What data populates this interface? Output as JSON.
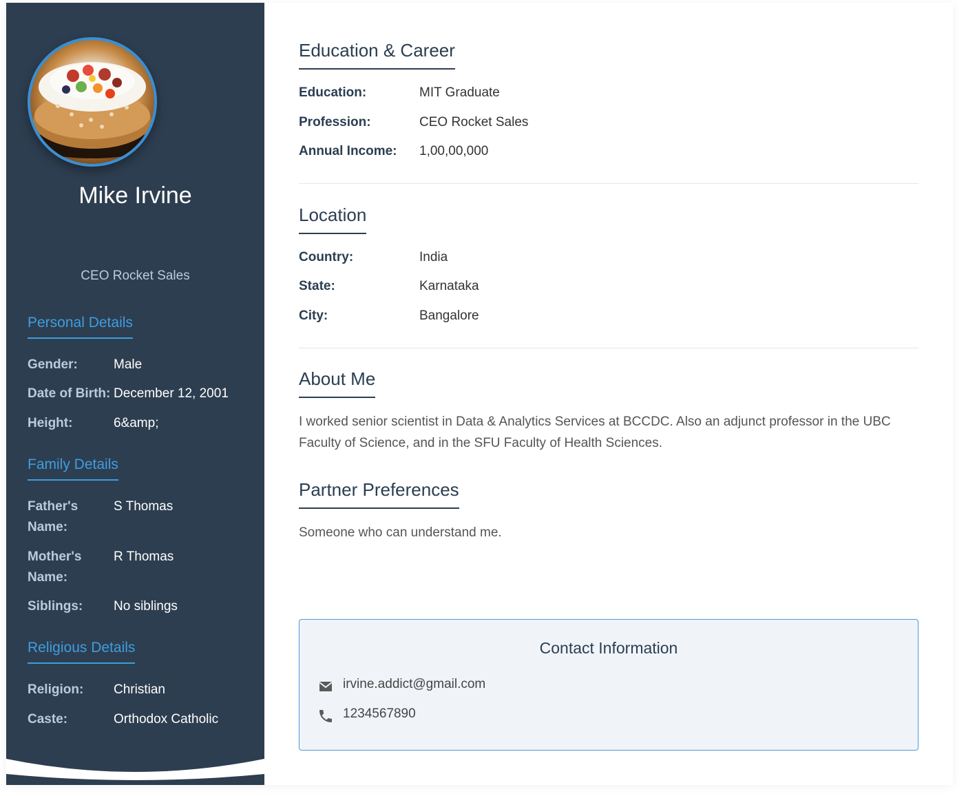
{
  "profile": {
    "name": "Mike Irvine",
    "tagline": "CEO Rocket Sales"
  },
  "personal": {
    "heading": "Personal Details",
    "rows": [
      {
        "label": "Gender:",
        "value": "Male"
      },
      {
        "label": "Date of Birth:",
        "value": "December 12, 2001"
      },
      {
        "label": "Height:",
        "value": "6&amp;"
      }
    ]
  },
  "family": {
    "heading": "Family Details",
    "rows": [
      {
        "label": "Father's Name:",
        "value": "S Thomas"
      },
      {
        "label": "Mother's Name:",
        "value": "R Thomas"
      },
      {
        "label": "Siblings:",
        "value": "No siblings"
      }
    ]
  },
  "religious": {
    "heading": "Religious Details",
    "rows": [
      {
        "label": "Religion:",
        "value": "Christian"
      },
      {
        "label": "Caste:",
        "value": "Orthodox Catholic"
      }
    ]
  },
  "education": {
    "heading": "Education & Career",
    "rows": [
      {
        "label": "Education:",
        "value": "MIT Graduate"
      },
      {
        "label": "Profession:",
        "value": "CEO Rocket Sales"
      },
      {
        "label": "Annual Income:",
        "value": "1,00,00,000"
      }
    ]
  },
  "location": {
    "heading": "Location",
    "rows": [
      {
        "label": "Country:",
        "value": "India"
      },
      {
        "label": "State:",
        "value": "Karnataka"
      },
      {
        "label": "City:",
        "value": "Bangalore"
      }
    ]
  },
  "about": {
    "heading": "About Me",
    "text": "I worked senior scientist in Data & Analytics Services at BCCDC. Also an adjunct professor in the UBC Faculty of Science, and in the SFU Faculty of Health Sciences."
  },
  "partner": {
    "heading": "Partner Preferences",
    "text": "Someone who can understand me."
  },
  "contact": {
    "heading": "Contact Information",
    "email": "irvine.addict@gmail.com",
    "phone": "1234567890",
    "email_icon": "mail-icon",
    "phone_icon": "phone-icon"
  },
  "colors": {
    "sidebar_bg": "#2d3e50",
    "accent": "#3f9de0",
    "heading": "#2b3e52"
  }
}
